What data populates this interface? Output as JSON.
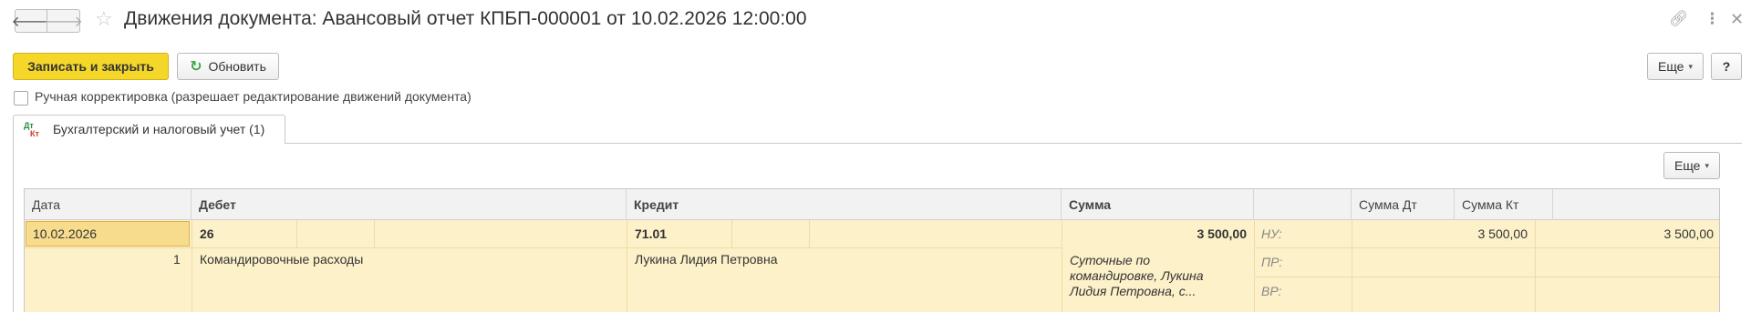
{
  "window": {
    "title": "Движения документа: Авансовый отчет КПБП-000001 от 10.02.2026 12:00:00",
    "icons": [
      "back-arrow",
      "forward-arrow",
      "favorite-star",
      "link-icon",
      "more-vertical-icon",
      "close-icon"
    ]
  },
  "toolbar": {
    "save_close_label": "Записать и закрыть",
    "refresh_label": "Обновить",
    "more_label": "Еще",
    "help_label": "?"
  },
  "manual_edit": {
    "checked": false,
    "label": "Ручная корректировка (разрешает редактирование движений документа)"
  },
  "tabs": [
    {
      "label": "Бухгалтерский и налоговый учет (1)",
      "icon_top": "Дт",
      "icon_bottom": "Кт",
      "active": true
    }
  ],
  "table_toolbar": {
    "more_label": "Еще"
  },
  "table": {
    "columns": [
      "Дата",
      "Дебет",
      "Кредит",
      "Сумма",
      "",
      "Сумма Дт",
      "Сумма Кт"
    ],
    "rows": [
      {
        "date": "10.02.2026",
        "line_no": "1",
        "debit_account": "26",
        "debit_subconto": "Командировочные расходы",
        "credit_account": "71.01",
        "credit_subconto": "Лукина Лидия Петровна",
        "amount": "3 500,00",
        "content": "Суточные по командировке, Лукина Лидия Петровна, с...",
        "tax_labels": [
          "НУ:",
          "ПР:",
          "ВР:"
        ],
        "sum_dt": "3 500,00",
        "sum_kt": "3 500,00"
      }
    ]
  },
  "colors": {
    "save_button": "#f5d72a",
    "row_highlight": "#fcf1c8",
    "selected_cell": "#f8dc8e"
  }
}
